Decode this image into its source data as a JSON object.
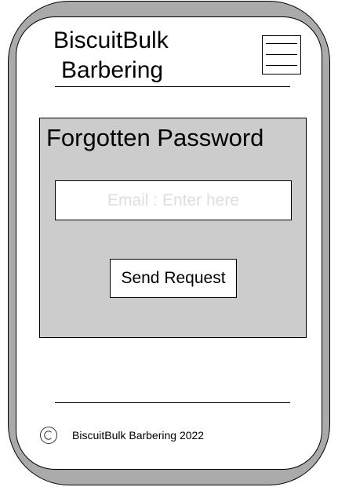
{
  "header": {
    "brand_line1": "BiscuitBulk",
    "brand_line2": "Barbering",
    "menu_icon": "hamburger-menu-icon"
  },
  "forgot_password": {
    "title": "Forgotten Password",
    "email_field": {
      "value": "",
      "placeholder": "Email : Enter here"
    },
    "submit_label": "Send Request"
  },
  "footer": {
    "copyright_icon": "copyright-icon",
    "text": "BiscuitBulk Barbering 2022"
  },
  "colors": {
    "frame": "#aaaaaa",
    "panel": "#cccccc",
    "placeholder": "#dedede",
    "screen": "#ffffff"
  }
}
